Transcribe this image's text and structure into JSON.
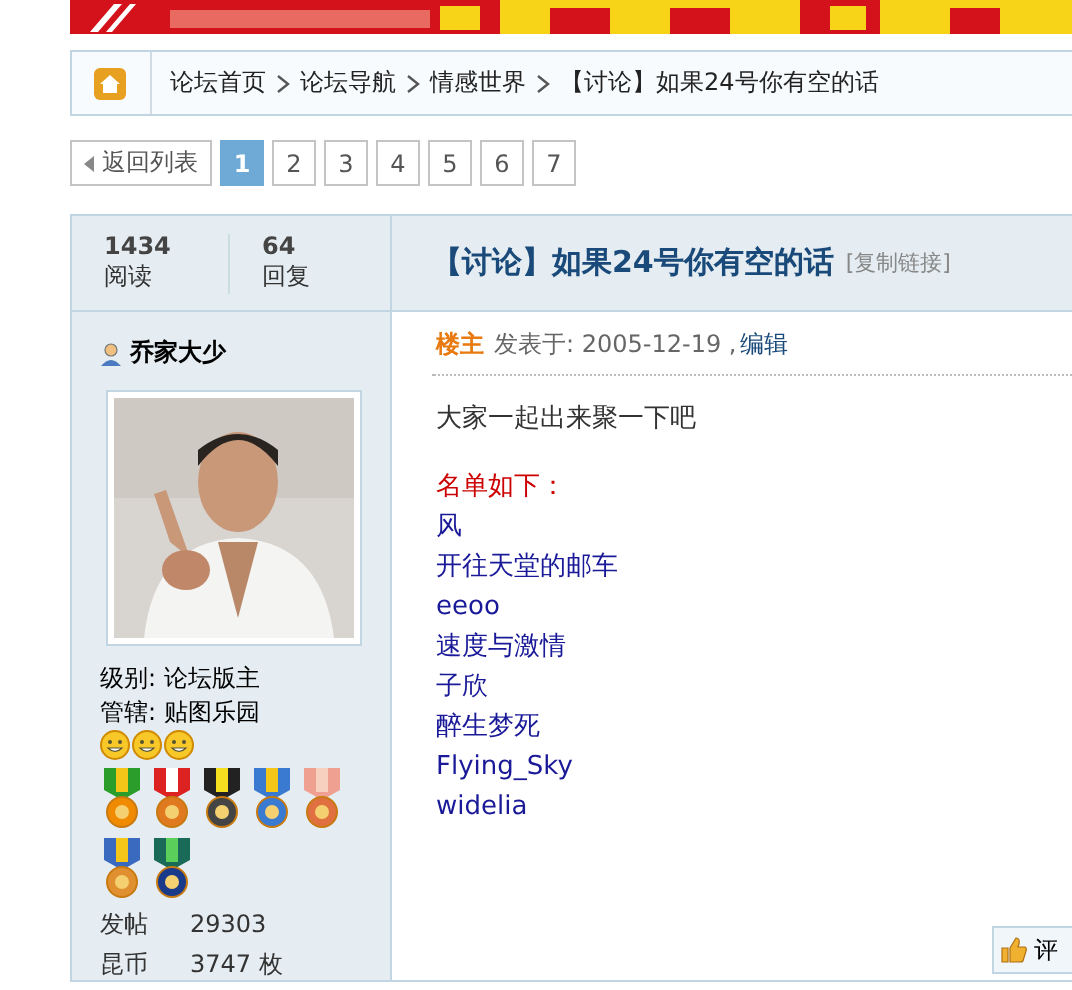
{
  "breadcrumb": {
    "items": [
      {
        "label": "论坛首页"
      },
      {
        "label": "论坛导航"
      },
      {
        "label": "情感世界"
      },
      {
        "label": "【讨论】如果24号你有空的话"
      }
    ]
  },
  "pagination": {
    "back": "返回列表",
    "pages": [
      {
        "label": "1",
        "selected": true
      },
      {
        "label": "2",
        "selected": false
      },
      {
        "label": "3",
        "selected": false
      },
      {
        "label": "4",
        "selected": false
      },
      {
        "label": "5",
        "selected": false
      },
      {
        "label": "6",
        "selected": false
      },
      {
        "label": "7",
        "selected": false
      }
    ]
  },
  "stats": [
    {
      "value": "1434",
      "label": "阅读"
    },
    {
      "value": "64",
      "label": "回复"
    }
  ],
  "thread": {
    "title": "【讨论】如果24号你有空的话",
    "copy_link": "[复制链接]"
  },
  "author": {
    "name": "乔家大少",
    "level": "级别: 论坛版主",
    "manages": "管辖: 贴图乐园",
    "details": [
      {
        "label": "发帖",
        "value": "29303"
      },
      {
        "label": "昆币",
        "value": "3747 枚"
      }
    ]
  },
  "post": {
    "role": "楼主",
    "posted": "发表于: 2005-12-19 ,",
    "edit": "编辑",
    "lines": [
      {
        "kind": "text",
        "text": "大家一起出来聚一下吧"
      },
      {
        "kind": "gap"
      },
      {
        "kind": "heading",
        "text": "名单如下："
      },
      {
        "kind": "name",
        "text": "风"
      },
      {
        "kind": "name",
        "text": "开往天堂的邮车"
      },
      {
        "kind": "name",
        "text": "eeoo"
      },
      {
        "kind": "name",
        "text": "速度与激情"
      },
      {
        "kind": "name",
        "text": "子欣"
      },
      {
        "kind": "name",
        "text": "醉生梦死"
      },
      {
        "kind": "name",
        "text": "Flying_Sky"
      },
      {
        "kind": "name",
        "text": "widelia"
      }
    ]
  },
  "rate_button": {
    "label": "评"
  }
}
